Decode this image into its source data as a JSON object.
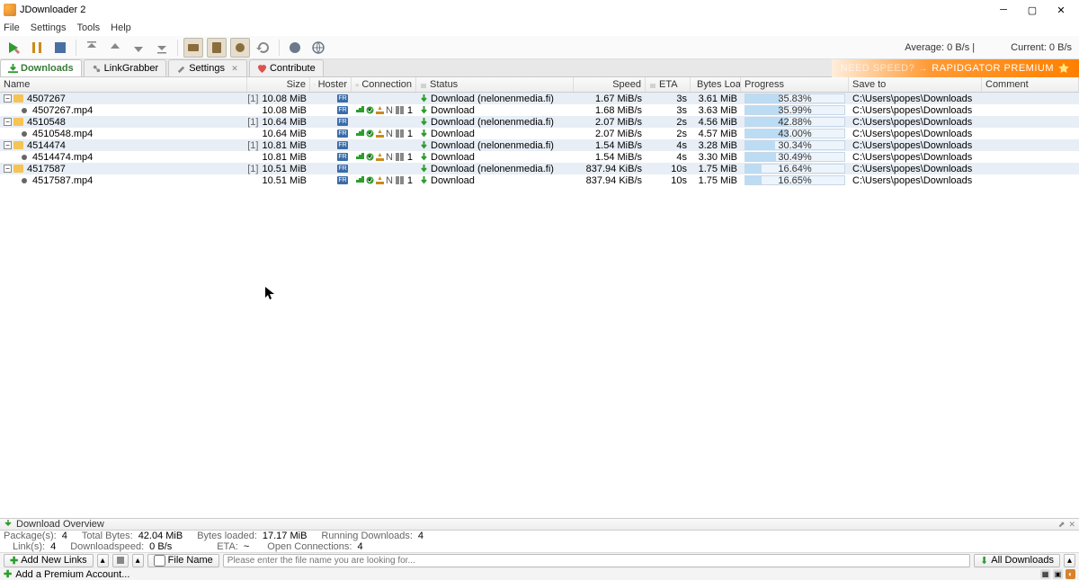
{
  "app": {
    "title": "JDownloader 2"
  },
  "menu": {
    "file": "File",
    "settings": "Settings",
    "tools": "Tools",
    "help": "Help"
  },
  "toolbar": {
    "avg": "Average: 0 B/s |",
    "current": "Current: 0 B/s"
  },
  "tabs": {
    "downloads": "Downloads",
    "linkgrabber": "LinkGrabber",
    "settings": "Settings",
    "contribute": "Contribute"
  },
  "banner": {
    "faint": "NEED SPEED? →",
    "bold": "RAPIDGATOR PREMIUM"
  },
  "columns": {
    "name": "Name",
    "size": "Size",
    "hoster": "Hoster",
    "conn": "Connection",
    "status": "Status",
    "speed": "Speed",
    "eta": "ETA",
    "bytes": "Bytes Loaded",
    "progress": "Progress",
    "save": "Save to",
    "comment": "Comment"
  },
  "rows": [
    {
      "type": "pkg",
      "name": "4507267",
      "cnt": "[1]",
      "size": "10.08 MiB",
      "status": "Download (nelonenmedia.fi)",
      "speed": "1.67 MiB/s",
      "eta": "3s",
      "bytes": "3.61 MiB",
      "pct": "35.83%",
      "save": "C:\\Users\\popes\\Downloads"
    },
    {
      "type": "child",
      "name": "4507267.mp4",
      "size": "10.08 MiB",
      "status": "Download",
      "speed": "1.68 MiB/s",
      "eta": "3s",
      "bytes": "3.63 MiB",
      "pct": "35.99%",
      "save": "C:\\Users\\popes\\Downloads"
    },
    {
      "type": "pkg",
      "name": "4510548",
      "cnt": "[1]",
      "size": "10.64 MiB",
      "status": "Download (nelonenmedia.fi)",
      "speed": "2.07 MiB/s",
      "eta": "2s",
      "bytes": "4.56 MiB",
      "pct": "42.88%",
      "save": "C:\\Users\\popes\\Downloads"
    },
    {
      "type": "child",
      "name": "4510548.mp4",
      "size": "10.64 MiB",
      "status": "Download",
      "speed": "2.07 MiB/s",
      "eta": "2s",
      "bytes": "4.57 MiB",
      "pct": "43.00%",
      "save": "C:\\Users\\popes\\Downloads"
    },
    {
      "type": "pkg",
      "name": "4514474",
      "cnt": "[1]",
      "size": "10.81 MiB",
      "status": "Download (nelonenmedia.fi)",
      "speed": "1.54 MiB/s",
      "eta": "4s",
      "bytes": "3.28 MiB",
      "pct": "30.34%",
      "save": "C:\\Users\\popes\\Downloads"
    },
    {
      "type": "child",
      "name": "4514474.mp4",
      "size": "10.81 MiB",
      "status": "Download",
      "speed": "1.54 MiB/s",
      "eta": "4s",
      "bytes": "3.30 MiB",
      "pct": "30.49%",
      "save": "C:\\Users\\popes\\Downloads"
    },
    {
      "type": "pkg",
      "name": "4517587",
      "cnt": "[1]",
      "size": "10.51 MiB",
      "status": "Download (nelonenmedia.fi)",
      "speed": "837.94 KiB/s",
      "eta": "10s",
      "bytes": "1.75 MiB",
      "pct": "16.64%",
      "save": "C:\\Users\\popes\\Downloads"
    },
    {
      "type": "child",
      "name": "4517587.mp4",
      "size": "10.51 MiB",
      "status": "Download",
      "speed": "837.94 KiB/s",
      "eta": "10s",
      "bytes": "1.75 MiB",
      "pct": "16.65%",
      "save": "C:\\Users\\popes\\Downloads"
    }
  ],
  "overview": {
    "title": "Download Overview",
    "packages_l": "Package(s):",
    "packages_v": "4",
    "totalbytes_l": "Total Bytes:",
    "totalbytes_v": "42.04 MiB",
    "bytesloaded_l": "Bytes loaded:",
    "bytesloaded_v": "17.17 MiB",
    "running_l": "Running Downloads:",
    "running_v": "4",
    "links_l": "Link(s):",
    "links_v": "4",
    "dlspeed_l": "Downloadspeed:",
    "dlspeed_v": "0 B/s",
    "eta_l": "ETA:",
    "eta_v": "~",
    "openconn_l": "Open Connections:",
    "openconn_v": "4"
  },
  "bottombar": {
    "addlinks": "Add New Links",
    "filename": "File Name",
    "search_ph": "Please enter the file name you are looking for...",
    "alldl": "All Downloads"
  },
  "premiumbar": {
    "add": "Add a Premium Account..."
  }
}
